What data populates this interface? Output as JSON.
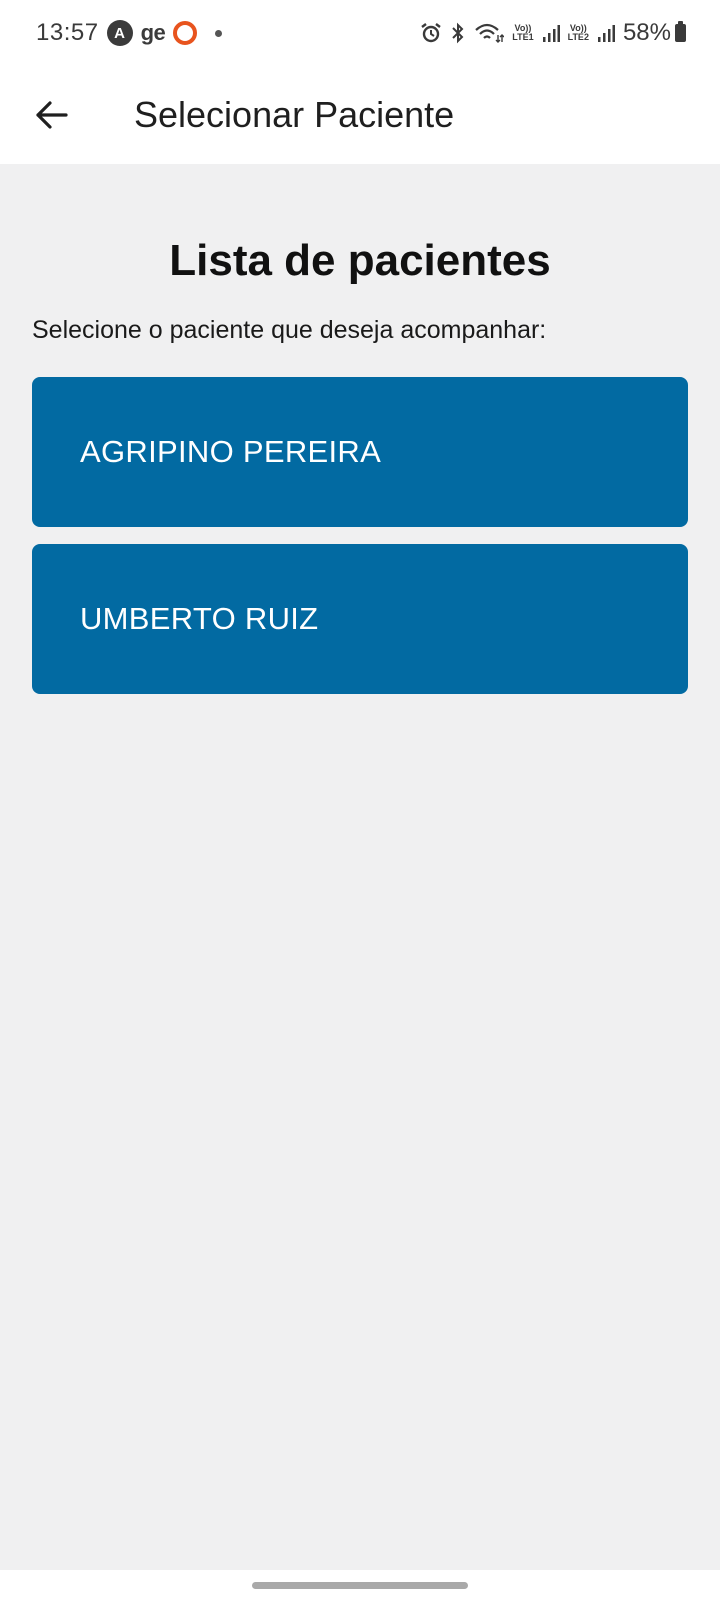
{
  "status_bar": {
    "time": "13:57",
    "app_icons": [
      "a-app-icon",
      "ge-app-icon",
      "ring-app-icon"
    ],
    "ge_label": "ge",
    "a_label": "A",
    "lte1": {
      "top": "Vo))",
      "bottom": "LTE1"
    },
    "lte2": {
      "top": "Vo))",
      "bottom": "LTE2"
    },
    "battery": "58%"
  },
  "app_bar": {
    "back_icon": "arrow-left-icon",
    "title": "Selecionar Paciente"
  },
  "main": {
    "heading": "Lista de pacientes",
    "instruction": "Selecione o paciente que deseja acompanhar:",
    "patients": [
      {
        "name": "AGRIPINO PEREIRA"
      },
      {
        "name": "UMBERTO RUIZ"
      }
    ]
  },
  "colors": {
    "card": "#026aa2",
    "background": "#f0f0f1",
    "bar": "#ffffff",
    "accent_ring": "#e8541e"
  }
}
